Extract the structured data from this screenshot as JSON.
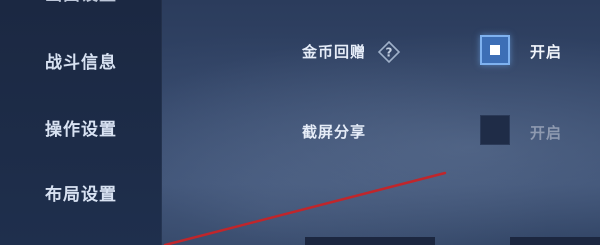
{
  "sidebar": {
    "items": [
      {
        "label": "画面设置"
      },
      {
        "label": "战斗信息"
      },
      {
        "label": "操作设置"
      },
      {
        "label": "布局设置"
      }
    ]
  },
  "settings": {
    "rows": [
      {
        "label": "金币回赠",
        "has_help": true,
        "help_icon": "diamond-question-icon",
        "checked": true,
        "option_label": "开启"
      },
      {
        "label": "截屏分享",
        "has_help": false,
        "checked": false,
        "option_label": "开启"
      }
    ]
  },
  "colors": {
    "accent_checked": "#3d6fb6",
    "annotation_stroke": "#c0262b"
  }
}
